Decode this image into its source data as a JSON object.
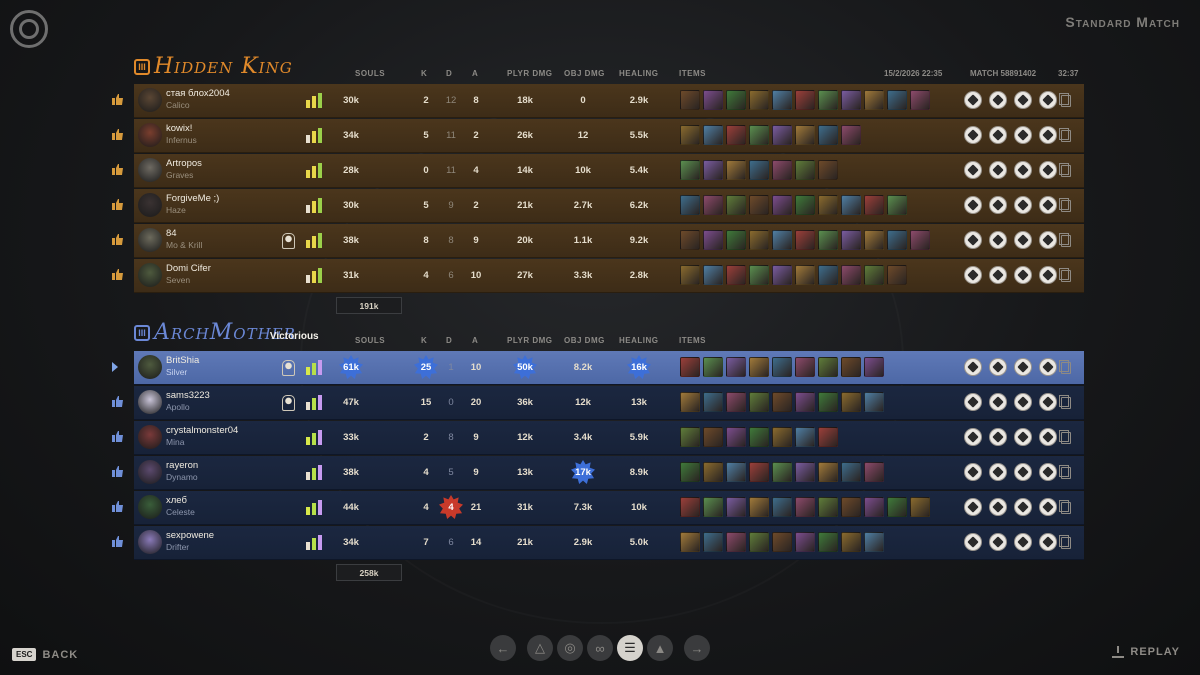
{
  "mode": "Standard Match",
  "match_info": {
    "date": "15/2/2026 22:35",
    "match_label": "MATCH 58891402",
    "duration": "32:37"
  },
  "columns": {
    "souls": "SOULS",
    "k": "K",
    "d": "D",
    "a": "A",
    "plyr_dmg": "PLYR DMG",
    "obj_dmg": "OBJ DMG",
    "healing": "HEALING",
    "items": "ITEMS"
  },
  "colors": {
    "team1_accent": "#e0892a",
    "team2_accent": "#6b88d6",
    "badge_blue": "#3d6fd8",
    "badge_red": "#c83a2a"
  },
  "team1": {
    "name": "Hidden King",
    "icon_label": "III",
    "total_souls": "191k",
    "players": [
      {
        "name": "стая блох2004",
        "hero": "Calico",
        "souls": "30k",
        "k": "2",
        "d": "12",
        "a": "8",
        "plyr_dmg": "18k",
        "obj_dmg": "0",
        "healing": "2.9k"
      },
      {
        "name": "kowix!",
        "hero": "Infernus",
        "souls": "34k",
        "k": "5",
        "d": "11",
        "a": "2",
        "plyr_dmg": "26k",
        "obj_dmg": "12",
        "healing": "5.5k"
      },
      {
        "name": "Artropos",
        "hero": "Graves",
        "souls": "28k",
        "k": "0",
        "d": "11",
        "a": "4",
        "plyr_dmg": "14k",
        "obj_dmg": "10k",
        "healing": "5.4k"
      },
      {
        "name": "ForgiveMe ;)",
        "hero": "Haze",
        "souls": "30k",
        "k": "5",
        "d": "9",
        "a": "2",
        "plyr_dmg": "21k",
        "obj_dmg": "2.7k",
        "healing": "6.2k"
      },
      {
        "name": "84",
        "hero": "Mo & Krill",
        "souls": "38k",
        "k": "8",
        "d": "8",
        "a": "9",
        "plyr_dmg": "20k",
        "obj_dmg": "1.1k",
        "healing": "9.2k"
      },
      {
        "name": "Domi Cifer",
        "hero": "Seven",
        "souls": "31k",
        "k": "4",
        "d": "6",
        "a": "10",
        "plyr_dmg": "27k",
        "obj_dmg": "3.3k",
        "healing": "2.8k"
      }
    ]
  },
  "team2": {
    "name": "ArchMother",
    "icon_label": "III",
    "result": "Victorious",
    "total_souls": "258k",
    "players": [
      {
        "name": "BritShia",
        "hero": "Silver",
        "souls": "61k",
        "k": "25",
        "d": "1",
        "a": "10",
        "plyr_dmg": "50k",
        "obj_dmg": "8.2k",
        "healing": "16k"
      },
      {
        "name": "sams3223",
        "hero": "Apollo",
        "souls": "47k",
        "k": "15",
        "d": "0",
        "a": "20",
        "plyr_dmg": "36k",
        "obj_dmg": "12k",
        "healing": "13k"
      },
      {
        "name": "crystalmonster04",
        "hero": "Mina",
        "souls": "33k",
        "k": "2",
        "d": "8",
        "a": "9",
        "plyr_dmg": "12k",
        "obj_dmg": "3.4k",
        "healing": "5.9k"
      },
      {
        "name": "rayeron",
        "hero": "Dynamo",
        "souls": "38k",
        "k": "4",
        "d": "5",
        "a": "9",
        "plyr_dmg": "13k",
        "obj_dmg": "17k",
        "healing": "8.9k"
      },
      {
        "name": "хлеб",
        "hero": "Celeste",
        "souls": "44k",
        "k": "4",
        "d": "4",
        "a": "21",
        "plyr_dmg": "31k",
        "obj_dmg": "7.3k",
        "healing": "10k"
      },
      {
        "name": "sexpowene",
        "hero": "Drifter",
        "souls": "34k",
        "k": "7",
        "d": "6",
        "a": "14",
        "plyr_dmg": "21k",
        "obj_dmg": "2.9k",
        "healing": "5.0k"
      }
    ]
  },
  "footer": {
    "esc_key": "ESC",
    "back": "BACK",
    "replay": "REPLAY"
  },
  "nav_icons": [
    "arrow-left-icon",
    "trophy-icon",
    "medal-icon",
    "team-icon",
    "list-icon",
    "chart-icon",
    "arrow-right-icon"
  ]
}
